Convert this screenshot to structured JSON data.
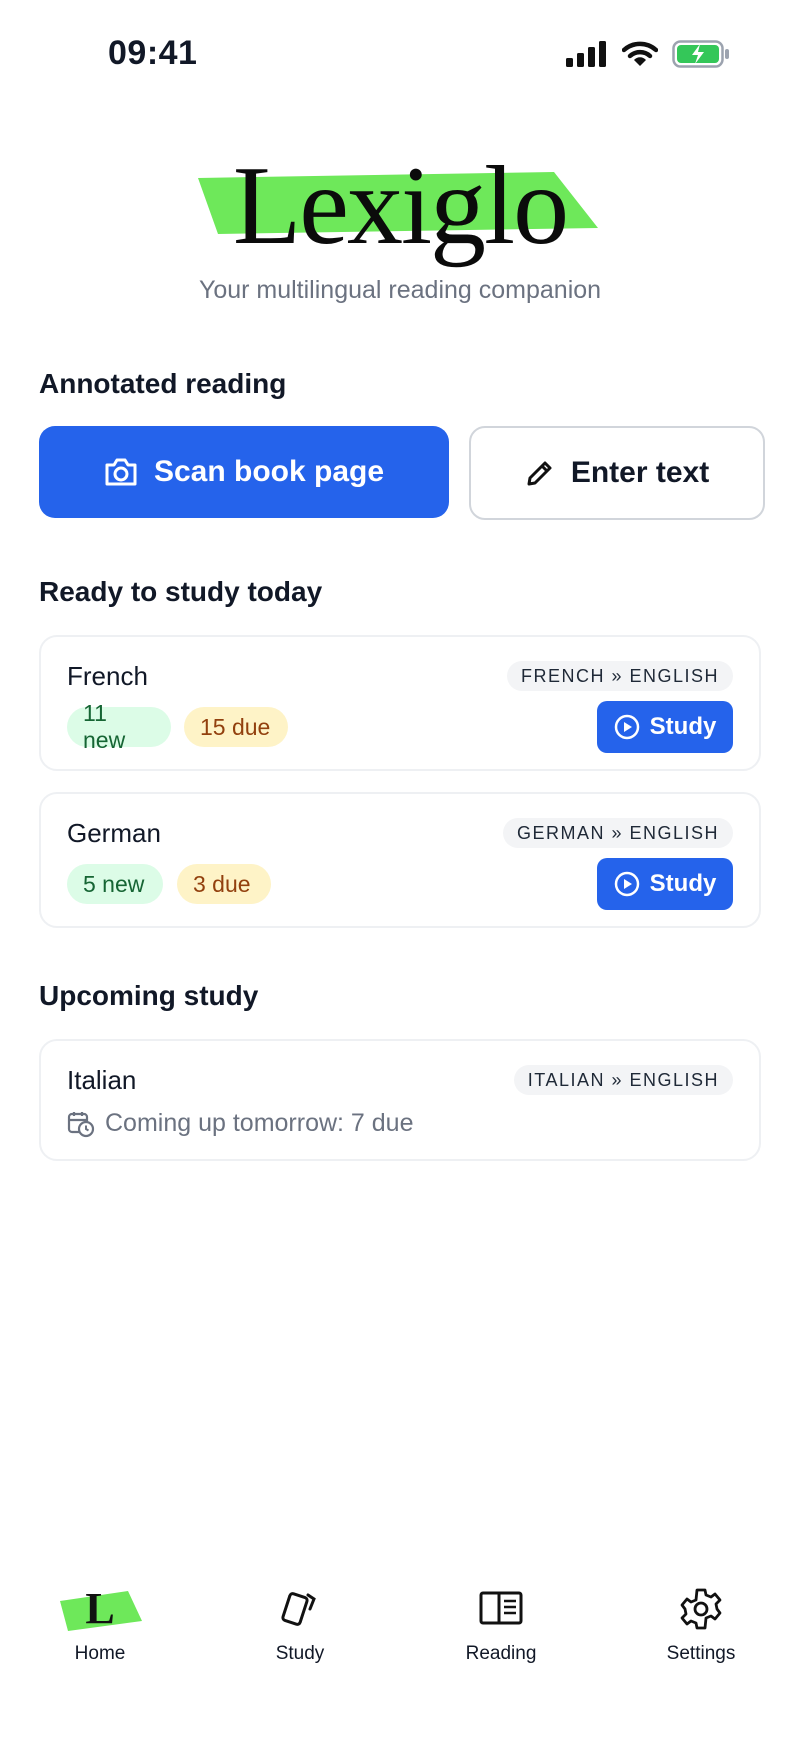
{
  "status_bar": {
    "time": "09:41"
  },
  "brand": {
    "name": "Lexiglo",
    "tagline": "Your multilingual reading companion",
    "accent": "#6ee85a"
  },
  "annotated_reading": {
    "title": "Annotated reading",
    "scan_label": "Scan book page",
    "enter_text_label": "Enter text"
  },
  "ready": {
    "title": "Ready to study today",
    "decks": [
      {
        "name": "French",
        "pair": "FRENCH » ENGLISH",
        "new_count": "11 new",
        "due_count": "15 due",
        "study_label": "Study"
      },
      {
        "name": "German",
        "pair": "GERMAN » ENGLISH",
        "new_count": "5 new",
        "due_count": "3 due",
        "study_label": "Study"
      }
    ]
  },
  "upcoming": {
    "title": "Upcoming study",
    "decks": [
      {
        "name": "Italian",
        "pair": "ITALIAN » ENGLISH",
        "note": "Coming up tomorrow: 7 due"
      }
    ]
  },
  "nav": {
    "items": [
      {
        "label": "Home",
        "icon": "home-logo-icon",
        "active": true
      },
      {
        "label": "Study",
        "icon": "cards-icon"
      },
      {
        "label": "Reading",
        "icon": "book-icon"
      },
      {
        "label": "Settings",
        "icon": "gear-icon"
      }
    ]
  },
  "colors": {
    "primary": "#2563eb",
    "new_bg": "#dcfce7",
    "due_bg": "#fef3c7"
  }
}
